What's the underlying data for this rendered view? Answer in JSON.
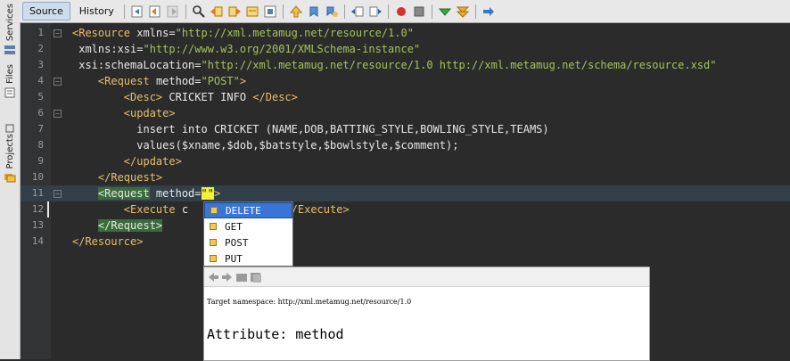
{
  "sidebar": {
    "tabs": [
      {
        "label": "Services"
      },
      {
        "label": "Files"
      },
      {
        "label": "Projects"
      }
    ]
  },
  "toolbar": {
    "tabs": [
      {
        "label": "Source",
        "active": true
      },
      {
        "label": "History",
        "active": false
      }
    ],
    "icons": [
      "last-edit-icon",
      "back-icon",
      "forward-icon",
      "find-icon",
      "find-previous-icon",
      "find-next-icon",
      "toggle-highlight-icon",
      "toggle-rectangular-icon",
      "previous-bookmark-icon",
      "next-bookmark-icon",
      "toggle-bookmark-icon",
      "shift-left-icon",
      "shift-right-icon",
      "start-macro-icon",
      "stop-macro-icon",
      "check-xml-icon",
      "validate-xml-icon",
      "xsl-transform-icon"
    ]
  },
  "editor": {
    "lines": [
      {
        "n": "1",
        "segs": [
          [
            "tag",
            "<Resource "
          ],
          [
            "attr",
            "xmlns="
          ],
          [
            "str",
            "\"http://xml.metamug.net/resource/1.0\""
          ]
        ]
      },
      {
        "n": "2",
        "segs": [
          [
            "attr",
            " xmlns:xsi="
          ],
          [
            "str",
            "\"http://www.w3.org/2001/XMLSchema-instance\""
          ]
        ]
      },
      {
        "n": "3",
        "segs": [
          [
            "attr",
            " xsi:schemaLocation="
          ],
          [
            "str",
            "\"http://xml.metamug.net/resource/1.0 http://xml.metamug.net/schema/resource.xsd\""
          ]
        ]
      },
      {
        "n": "4",
        "segs": [
          [
            "txt",
            "    "
          ],
          [
            "tag",
            "<Request "
          ],
          [
            "attr",
            "method="
          ],
          [
            "str",
            "\"POST\""
          ],
          [
            "tag",
            ">"
          ]
        ]
      },
      {
        "n": "5",
        "segs": [
          [
            "txt",
            "        "
          ],
          [
            "tag",
            "<Desc>"
          ],
          [
            "txt",
            " CRICKET INFO "
          ],
          [
            "tag",
            "</Desc>"
          ]
        ]
      },
      {
        "n": "6",
        "segs": [
          [
            "txt",
            "        "
          ],
          [
            "tag",
            "<update>"
          ]
        ]
      },
      {
        "n": "7",
        "segs": [
          [
            "txt",
            "          insert into CRICKET (NAME,DOB,BATTING_STYLE,BOWLING_STYLE,TEAMS)"
          ]
        ]
      },
      {
        "n": "8",
        "segs": [
          [
            "txt",
            "          values($xname,$dob,$batstyle,$bowlstyle,$comment);"
          ]
        ]
      },
      {
        "n": "9",
        "segs": [
          [
            "txt",
            "        "
          ],
          [
            "tag",
            "</update>"
          ]
        ]
      },
      {
        "n": "10",
        "segs": [
          [
            "txt",
            "    "
          ],
          [
            "tag",
            "</Request>"
          ]
        ]
      },
      {
        "n": "11",
        "segs": [
          [
            "txt",
            "    "
          ],
          [
            "tag",
            "<Request"
          ],
          [
            "attr",
            " method="
          ],
          [
            "str",
            "\"\""
          ],
          [
            "tag",
            ">"
          ]
        ],
        "current": true
      },
      {
        "n": "12",
        "segs": [
          [
            "txt",
            "        "
          ],
          [
            "tag",
            "<Execute "
          ],
          [
            "txt",
            "c"
          ],
          [
            "txt",
            "               "
          ],
          [
            "tag",
            "</Execute>"
          ]
        ]
      },
      {
        "n": "13",
        "segs": [
          [
            "txt",
            "    "
          ],
          [
            "tag",
            "</Request>"
          ]
        ]
      },
      {
        "n": "14",
        "segs": [
          [
            "tag",
            "</Resource>"
          ]
        ]
      }
    ]
  },
  "completion": {
    "options": [
      {
        "label": "DELETE",
        "selected": true
      },
      {
        "label": "GET"
      },
      {
        "label": "POST"
      },
      {
        "label": "PUT"
      }
    ]
  },
  "doc": {
    "target_namespace": "Target namespace: http://xml.metamug.net/resource/1.0",
    "attribute_heading": "Attribute: method"
  },
  "colors": {
    "tag": "#e8bf6a",
    "string": "#a5c25c",
    "selection": "#3875d7"
  }
}
